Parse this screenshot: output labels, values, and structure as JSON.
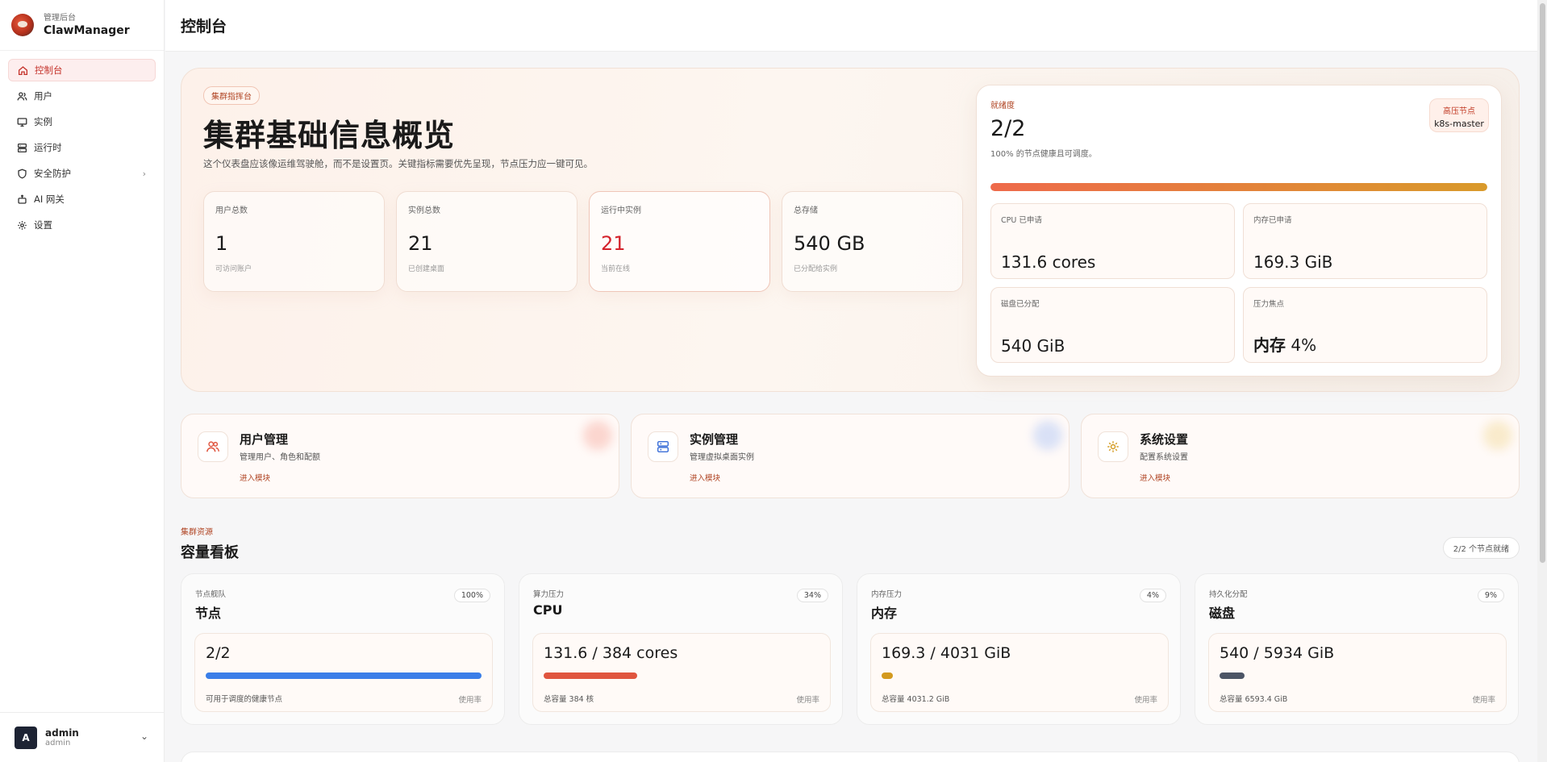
{
  "brand": {
    "subtitle": "管理后台",
    "title": "ClawManager"
  },
  "nav": [
    {
      "label": "控制台",
      "icon": "home-icon",
      "active": true
    },
    {
      "label": "用户",
      "icon": "users-icon"
    },
    {
      "label": "实例",
      "icon": "monitor-icon"
    },
    {
      "label": "运行时",
      "icon": "server-icon"
    },
    {
      "label": "安全防护",
      "icon": "shield-icon",
      "has_children": true
    },
    {
      "label": "AI 网关",
      "icon": "robot-icon"
    },
    {
      "label": "设置",
      "icon": "gear-icon"
    }
  ],
  "user": {
    "avatar": "A",
    "name": "admin",
    "role": "admin"
  },
  "header": {
    "title": "控制台"
  },
  "hero": {
    "tag": "集群指挥台",
    "title": "集群基础信息概览",
    "description": "这个仪表盘应该像运维驾驶舱，而不是设置页。关键指标需要优先呈现，节点压力应一键可见。",
    "stats": [
      {
        "label": "用户总数",
        "value": "1",
        "sub": "可访问账户"
      },
      {
        "label": "实例总数",
        "value": "21",
        "sub": "已创建桌面"
      },
      {
        "label": "运行中实例",
        "value": "21",
        "sub": "当前在线",
        "highlight": true
      },
      {
        "label": "总存储",
        "value": "540 GB",
        "sub": "已分配给实例"
      }
    ],
    "readiness": {
      "label": "就绪度",
      "value": "2/2",
      "description": "100% 的节点健康且可调度。",
      "progress": 1.0,
      "node_badge": {
        "label": "高压节点",
        "value": "k8s-master"
      },
      "metrics": [
        {
          "label": "CPU 已申请",
          "value": "131.6 cores"
        },
        {
          "label": "内存已申请",
          "value": "169.3 GiB"
        },
        {
          "label": "磁盘已分配",
          "value": "540 GiB"
        },
        {
          "label": "压力焦点",
          "value_bold": "内存",
          "value": " 4%"
        }
      ]
    }
  },
  "modules": [
    {
      "title": "用户管理",
      "description": "管理用户、角色和配额",
      "link": "进入模块",
      "icon": "users-icon",
      "color": "#e0553f",
      "glow": "#f7b2a6"
    },
    {
      "title": "实例管理",
      "description": "管理虚拟桌面实例",
      "link": "进入模块",
      "icon": "server-icon",
      "color": "#3b6fd8",
      "glow": "#b3c8f5"
    },
    {
      "title": "系统设置",
      "description": "配置系统设置",
      "link": "进入模块",
      "icon": "gear-icon",
      "color": "#d39a1f",
      "glow": "#f3dca0"
    }
  ],
  "capacity": {
    "kicker": "集群资源",
    "title": "容量看板",
    "ready_badge": "2/2 个节点就绪",
    "cards": [
      {
        "label": "节点舰队",
        "name": "节点",
        "percent": "100%",
        "value": "2/2",
        "fill": 1.0,
        "color": "#3a7ee8",
        "foot": "可用于调度的健康节点",
        "usage": "使用率"
      },
      {
        "label": "算力压力",
        "name": "CPU",
        "percent": "34%",
        "value": "131.6 / 384 cores",
        "fill": 0.34,
        "color": "#e0553f",
        "foot": "总容量 384 核",
        "usage": "使用率"
      },
      {
        "label": "内存压力",
        "name": "内存",
        "percent": "4%",
        "value": "169.3 / 4031 GiB",
        "fill": 0.04,
        "color": "#d39a1f",
        "foot": "总容量 4031.2 GiB",
        "usage": "使用率"
      },
      {
        "label": "持久化分配",
        "name": "磁盘",
        "percent": "9%",
        "value": "540 / 5934 GiB",
        "fill": 0.09,
        "color": "#4c5566",
        "foot": "总容量 6593.4 GiB",
        "usage": "使用率"
      }
    ]
  }
}
